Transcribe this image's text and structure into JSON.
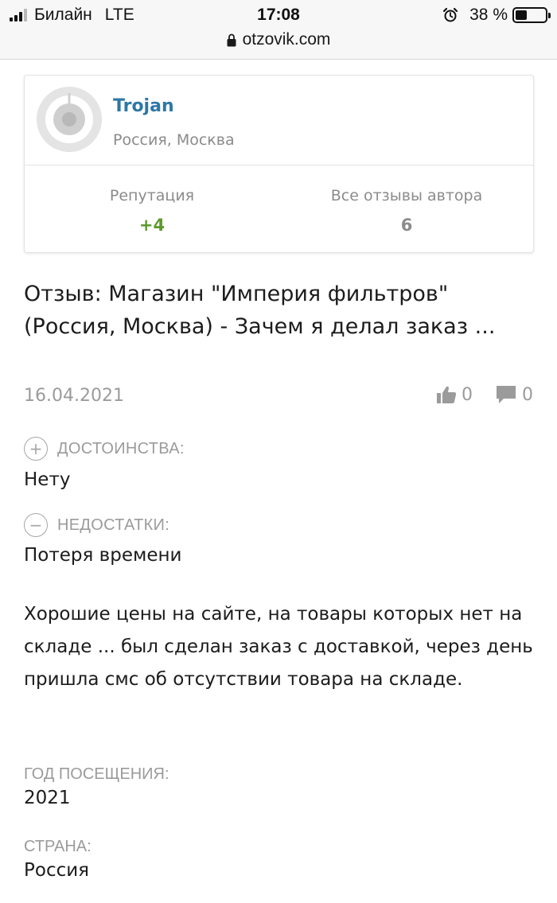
{
  "status_bar": {
    "carrier": "Билайн",
    "network": "LTE",
    "time": "17:08",
    "battery_percent": "38 %",
    "battery_level": 0.38,
    "icons": [
      "signal-icon",
      "alarm-icon",
      "battery-icon"
    ]
  },
  "browser": {
    "url": "otzovik.com",
    "icon": "lock-icon"
  },
  "author": {
    "name": "Trojan",
    "location": "Россия, Москва",
    "reputation_label": "Репутация",
    "reputation_value": "+4",
    "reviews_label": "Все отзывы автора",
    "reviews_value": "6",
    "colors": {
      "name": "#2c78a6",
      "reputation": "#5d9a2c"
    }
  },
  "review": {
    "title": "Отзыв: Магазин \"Империя фильтров\" (Россия, Москва) - Зачем я делал заказ ...",
    "date": "16.04.2021",
    "likes": "0",
    "comments": "0",
    "pros_label": "ДОСТОИНСТВА:",
    "pros": "Нету",
    "cons_label": "НЕДОСТАТКИ:",
    "cons": "Потеря времени",
    "text": "Хорошие цены на сайте, на товары которых нет на складе ... был сделан заказ с доставкой, через день пришла смс об отсутствии товара на складе.",
    "visit_year_label": "ГОД ПОСЕЩЕНИЯ:",
    "visit_year": "2021",
    "country_label": "СТРАНА:",
    "country": "Россия"
  }
}
